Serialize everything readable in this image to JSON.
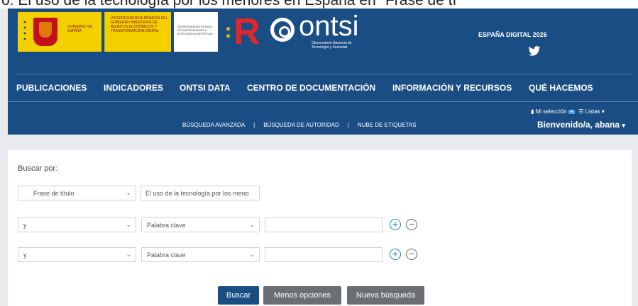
{
  "page_title_cut": "o: El uso de la tecnología por los menores en España en \"Frase de tí",
  "header": {
    "gov_label": "GOBIERNO DE ESPAÑA",
    "vicepresidency_label": "VICEPRESIDENCIA PRIMERA DEL GOBIERNO MINISTERIO DE ASUNTOS ECONÓMICOS Y TRANSFORMACIÓN DIGITAL",
    "secretariat_label": "SECRETARÍA DE ESTADO DE DIGITALIZACIÓN E INTELIGENCIA ARTIFICIAL",
    "ontsi_name": "ontsi",
    "ontsi_subtitle": "Observatorio Nacional de Tecnología y Sociedad",
    "espana_digital": "ESPAÑA DIGITAL 2026"
  },
  "nav": {
    "items": [
      "PUBLICACIONES",
      "INDICADORES",
      "ONTSI DATA",
      "CENTRO DE DOCUMENTACIÓN",
      "INFORMACIÓN Y RECURSOS",
      "QUÉ HACEMOS"
    ]
  },
  "subnav": {
    "items": [
      "BÚSQUEDA AVANZADA",
      "BÚSQUEDA DE AUTORIDAD",
      "NUBE DE ETIQUETAS"
    ],
    "separator": "|"
  },
  "user": {
    "my_selection": "Mi selección",
    "selection_count": "4",
    "lists": "Listas",
    "welcome": "Bienvenido/a, abana"
  },
  "search": {
    "label": "Buscar por:",
    "row1": {
      "field": "Frase de título",
      "value": "El uso de la tecnología por los meno"
    },
    "row2": {
      "operator": "y",
      "field": "Palabra clave",
      "value": ""
    },
    "row3": {
      "operator": "y",
      "field": "Palabra clave",
      "value": ""
    },
    "plus": "+",
    "minus": "−",
    "chevron": "⌄"
  },
  "buttons": {
    "search": "Buscar",
    "fewer_options": "Menos opciones",
    "new_search": "Nueva búsqueda"
  },
  "colors": {
    "header_blue": "#1b4d85",
    "accent_blue": "#1b7fc4",
    "badge_blue": "#4ba3e3",
    "grey_button": "#6b6f73"
  }
}
